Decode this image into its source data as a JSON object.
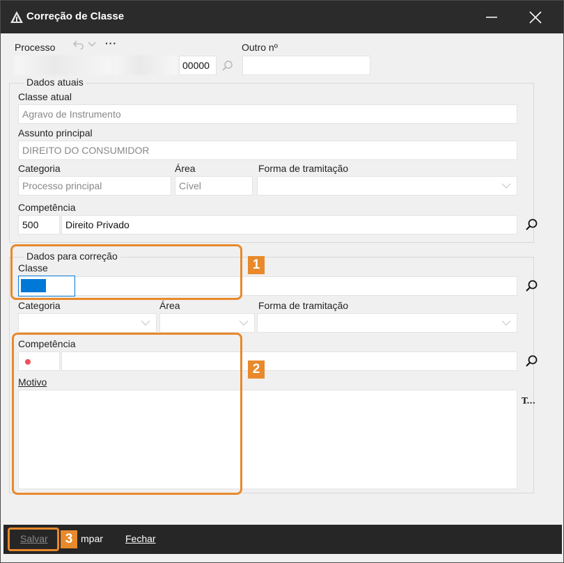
{
  "window": {
    "title": "Correção de Classe",
    "minimize_icon": "minimize-icon",
    "close_icon": "close-icon"
  },
  "processo": {
    "label": "Processo",
    "number_suffix": "00000",
    "outro_label": "Outro nº",
    "outro_value": "",
    "more_label": "···"
  },
  "dados_atuais": {
    "group_title": "Dados atuais",
    "classe_label": "Classe atual",
    "classe_value": "Agravo de Instrumento",
    "assunto_label": "Assunto principal",
    "assunto_value": "DIREITO DO CONSUMIDOR",
    "categoria_label": "Categoria",
    "categoria_value": "Processo principal",
    "area_label": "Área",
    "area_value": "Cível",
    "forma_label": "Forma de tramitação",
    "forma_value": "",
    "competencia_label": "Competência",
    "competencia_code": "500",
    "competencia_value": "Direito Privado"
  },
  "dados_correcao": {
    "group_title": "Dados para correção",
    "classe_label": "Classe",
    "classe_value": "",
    "categoria_label": "Categoria",
    "area_label": "Área",
    "forma_label": "Forma de tramitação",
    "competencia_label": "Competência",
    "motivo_label": "Motivo",
    "motivo_value": "",
    "text_tool_label": "T..."
  },
  "annotations": {
    "badge_1": "1",
    "badge_2": "2",
    "badge_3": "3",
    "accent_color": "#e8892b"
  },
  "footer": {
    "salvar": "Salvar",
    "limpar": "mpar",
    "fechar": "Fechar"
  },
  "colors": {
    "titlebar": "#2b2b2b",
    "footer": "#262626",
    "selection": "#0078d7",
    "required_dot": "#f0505a"
  }
}
